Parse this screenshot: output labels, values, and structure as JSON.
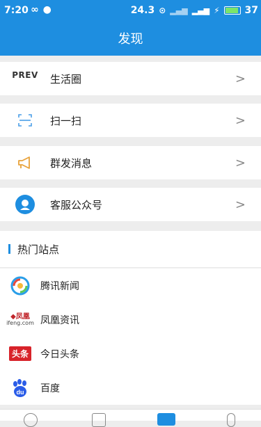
{
  "status_bar": {
    "time": "7:20",
    "speed": "24.3",
    "battery": "37"
  },
  "header": {
    "title": "发现"
  },
  "menu": {
    "items": [
      {
        "id": "life",
        "label": "生活圈",
        "icon": "prev-icon",
        "icon_text": "PREV"
      },
      {
        "id": "scan",
        "label": "扫一扫",
        "icon": "scan-icon"
      },
      {
        "id": "broadcast",
        "label": "群发消息",
        "icon": "megaphone-icon"
      },
      {
        "id": "service",
        "label": "客服公众号",
        "icon": "customer-service-icon"
      }
    ],
    "chevron": ">"
  },
  "hot_sites": {
    "title": "热门站点",
    "sites": [
      {
        "id": "tencent",
        "name": "腾讯新闻",
        "icon": "tencent-news-icon"
      },
      {
        "id": "ifeng",
        "name": "凤凰资讯",
        "icon": "ifeng-icon",
        "icon_text": "ifeng.com"
      },
      {
        "id": "toutiao",
        "name": "今日头条",
        "icon": "toutiao-icon",
        "icon_text": "头条"
      },
      {
        "id": "baidu",
        "name": "百度",
        "icon": "baidu-icon",
        "icon_text": "du"
      }
    ]
  },
  "colors": {
    "primary": "#1e8ee0",
    "background": "#ededed"
  }
}
